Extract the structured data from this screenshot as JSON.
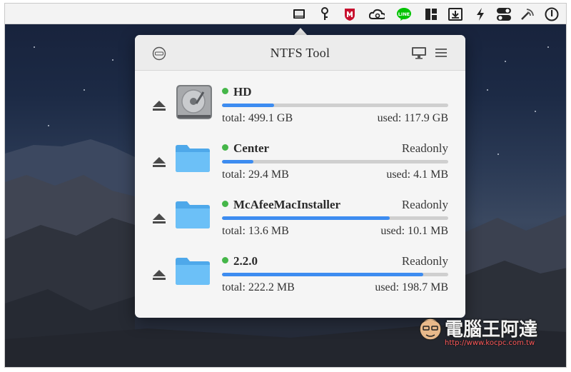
{
  "app": {
    "title": "NTFS Tool"
  },
  "menubar": {
    "icons": [
      "ntfs-tool-drive-icon",
      "key-icon",
      "mcafee-shield-icon",
      "creative-cloud-icon",
      "line-app-icon",
      "window-layout-icon",
      "download-box-icon",
      "bolt-icon",
      "toggle-switches-icon",
      "broadcast-icon",
      "power-icon"
    ],
    "line_label": "LINE"
  },
  "header": {
    "left_icon": "disk-logo-icon",
    "right_icons": [
      "monitor-icon",
      "menu-icon"
    ]
  },
  "drives": [
    {
      "name": "HD",
      "mode": "",
      "total": "total: 499.1 GB",
      "used": "used: 117.9 GB",
      "usage": 0.23,
      "icon": "hard-drive-icon",
      "mounted": true
    },
    {
      "name": "Center",
      "mode": "Readonly",
      "total": "total: 29.4 MB",
      "used": "used: 4.1 MB",
      "usage": 0.14,
      "icon": "folder-icon",
      "mounted": true
    },
    {
      "name": "McAfeeMacInstaller",
      "mode": "Readonly",
      "total": "total: 13.6 MB",
      "used": "used: 10.1 MB",
      "usage": 0.74,
      "icon": "folder-icon",
      "mounted": true
    },
    {
      "name": "2.2.0",
      "mode": "Readonly",
      "total": "total: 222.2 MB",
      "used": "used: 198.7 MB",
      "usage": 0.89,
      "icon": "folder-icon",
      "mounted": true
    }
  ],
  "watermark": {
    "text": "電腦王阿達",
    "url": "http://www.kocpc.com.tw"
  },
  "colors": {
    "accent": "#3d8cf0",
    "status_ok": "#45b649",
    "folder": "#5bb4f0"
  }
}
